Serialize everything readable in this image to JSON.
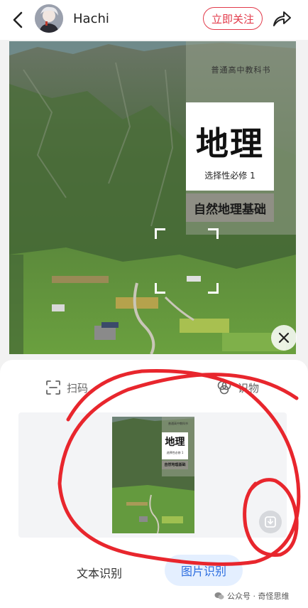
{
  "header": {
    "username": "Hachi",
    "follow_label": "立即关注"
  },
  "cover": {
    "series": "普通高中教科书",
    "title": "地理",
    "subtitle": "选择性必修 1",
    "band": "自然地理基础"
  },
  "sheet": {
    "tab_scan": "扫码",
    "tab_object": "识物",
    "mode_text": "文本识别",
    "mode_image": "图片识别",
    "watermark": "公众号 · 奇怪思维"
  },
  "colors": {
    "accent_red": "#e23a4a",
    "accent_blue": "#2f6fe0",
    "annotation_red": "#e8262d"
  },
  "icons": {
    "back": "chevron-left-icon",
    "share": "share-arrow-icon",
    "close": "close-icon",
    "scan": "scan-frame-icon",
    "object": "object-recognition-icon",
    "download": "download-icon"
  }
}
